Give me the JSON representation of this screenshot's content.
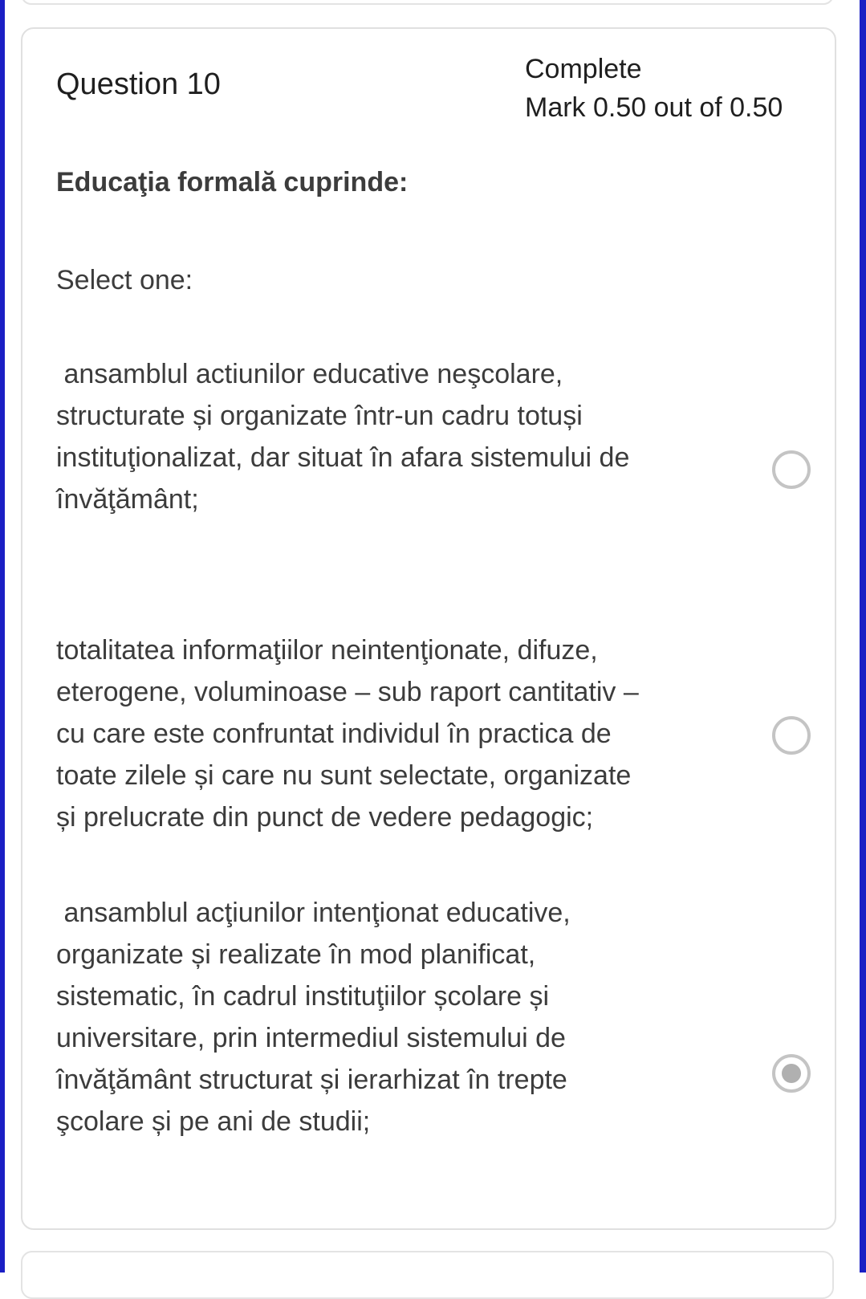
{
  "question": {
    "title": "Question 10",
    "state": "Complete",
    "grade": "Mark 0.50 out of 0.50",
    "text": "Educaţia formală cuprinde:",
    "prompt": "Select one:"
  },
  "answers": [
    {
      "text": " ansamblul actiunilor educative neşcolare,\nstructurate și organizate într-un cadru totuși\ninstituţionalizat, dar situat în afara sistemului de\nînvăţământ;",
      "selected": false
    },
    {
      "text": "totalitatea informaţiilor neintenţionate, difuze,\neterogene, voluminoase – sub raport cantitativ –\ncu care este confruntat individul în practica de\ntoate zilele și care nu sunt selectate, organizate\nși prelucrate din punct de vedere pedagogic;",
      "selected": false
    },
    {
      "text": " ansamblul acţiunilor intenţionat educative,\norganizate și realizate în mod planificat,\nsistematic, în cadrul instituţiilor școlare și\nuniversitare, prin intermediul sistemului de\nînvăţământ structurat și ierarhizat în trepte\nşcolare și pe ani de studii;",
      "selected": true
    }
  ]
}
